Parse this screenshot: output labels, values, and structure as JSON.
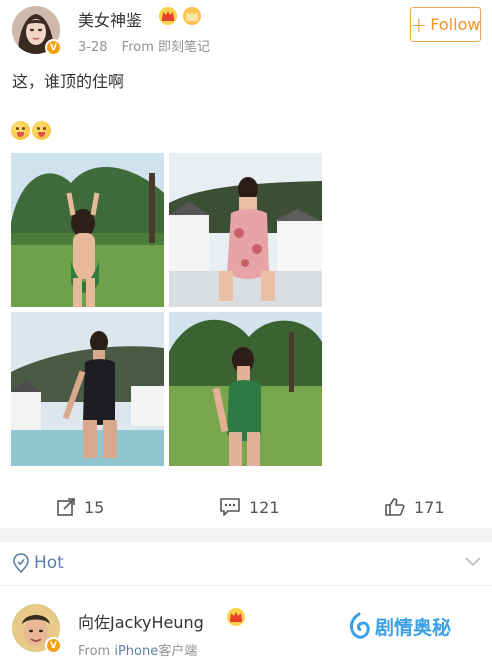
{
  "post": {
    "author": "美女神鉴",
    "date": "3-28",
    "source": "From 即刻笔记",
    "text": "这，谁顶的住啊",
    "follow_label": "Follow",
    "verified_badge": "V"
  },
  "photos": [
    {
      "scene": "green-swimsuit-back-lawn"
    },
    {
      "scene": "floral-swimsuit-rooftop"
    },
    {
      "scene": "black-swimsuit-pool"
    },
    {
      "scene": "green-swimsuit-lawn"
    }
  ],
  "actions": {
    "share_count": "15",
    "comment_count": "121",
    "like_count": "171"
  },
  "hot": {
    "label": "Hot"
  },
  "comment": {
    "author": "向佐JackyHeung",
    "source_prefix": "From ",
    "device": "iPhone",
    "source_suffix": "客户端"
  },
  "watermark": {
    "text": "剧情奥秘"
  },
  "colors": {
    "accent_orange": "#f29225",
    "badge_orange": "#f2a013",
    "link_blue": "#5b7fa8",
    "meta_gray": "#939393",
    "watermark_blue": "#3aa0e8"
  }
}
